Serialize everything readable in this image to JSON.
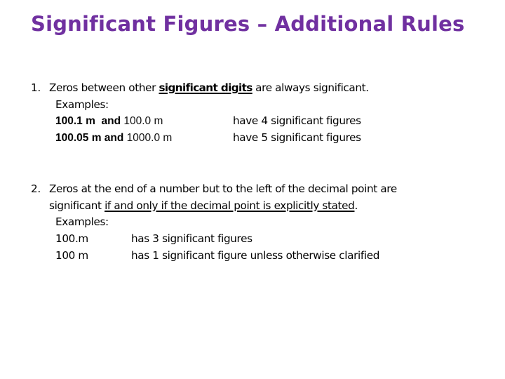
{
  "slide": {
    "title": "Significant Figures – Additional Rules",
    "title_color": "#7030A0"
  },
  "rules": [
    {
      "number": "1.",
      "text_before": "Zeros between other ",
      "underlined": "significant digits",
      "text_after": " are always significant.",
      "examples_label": "Examples:",
      "examples": [
        {
          "bold_part": "100.1 m  and ",
          "regular_part": "100.0 m",
          "result": "have 4 significant figures"
        },
        {
          "bold_part": "100.05 m and ",
          "regular_part": "1000.0 m",
          "result": "have 5 significant figures"
        }
      ]
    },
    {
      "number": "2.",
      "line1": "Zeros at the end of a number but to the left of the decimal point are",
      "line2_before": "significant ",
      "underlined": "if and only if the decimal point is explicitly stated",
      "line2_after": ".",
      "examples_label": "Examples:",
      "examples": [
        {
          "value": "100.m",
          "result": "has 3 significant figures"
        },
        {
          "value": "100 m",
          "result": "has 1 significant figure unless otherwise clarified"
        }
      ]
    }
  ]
}
